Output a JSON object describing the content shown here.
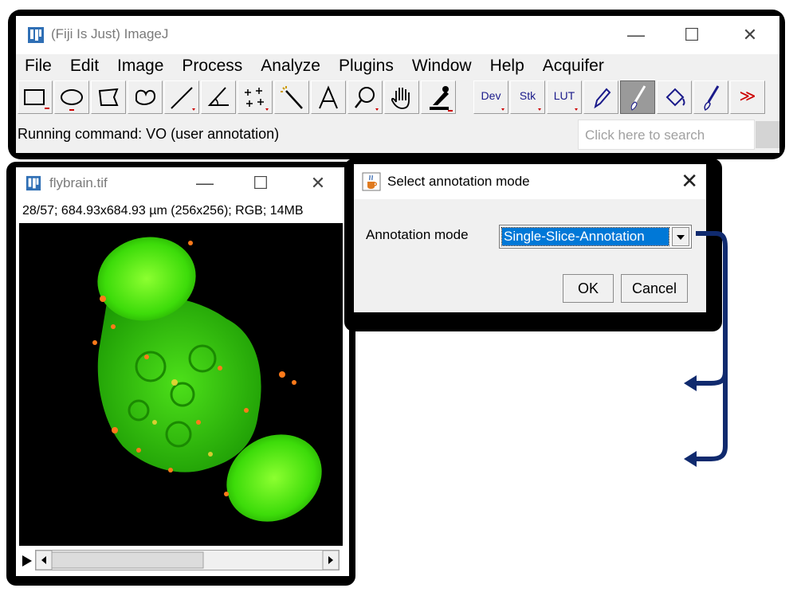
{
  "main_window": {
    "title": "(Fiji Is Just) ImageJ",
    "controls": {
      "minimize": "—",
      "maximize": "☐",
      "close": "✕"
    },
    "menu": [
      "File",
      "Edit",
      "Image",
      "Process",
      "Analyze",
      "Plugins",
      "Window",
      "Help",
      "Acquifer"
    ],
    "toolbar": {
      "text_tools": {
        "dev": "Dev",
        "stk": "Stk",
        "lut": "LUT",
        "more": "≫"
      },
      "active_tool": "brush-tool"
    },
    "status": "Running command: VO (user annotation)",
    "search_placeholder": "Click here to search"
  },
  "image_window": {
    "title": "flybrain.tif",
    "controls": {
      "minimize": "—",
      "maximize": "☐",
      "close": "✕"
    },
    "info": "28/57; 684.93x684.93 µm (256x256); RGB; 14MB"
  },
  "dialog": {
    "title": "Select annotation mode",
    "close": "✕",
    "label": "Annotation mode",
    "selected_value": "Single-Slice-Annotation",
    "ok_label": "OK",
    "cancel_label": "Cancel"
  },
  "colors": {
    "arrow": "#102a6e",
    "selection": "#0078d7",
    "image_green": "#3ddc0a",
    "image_orange": "#ff7a1a"
  }
}
